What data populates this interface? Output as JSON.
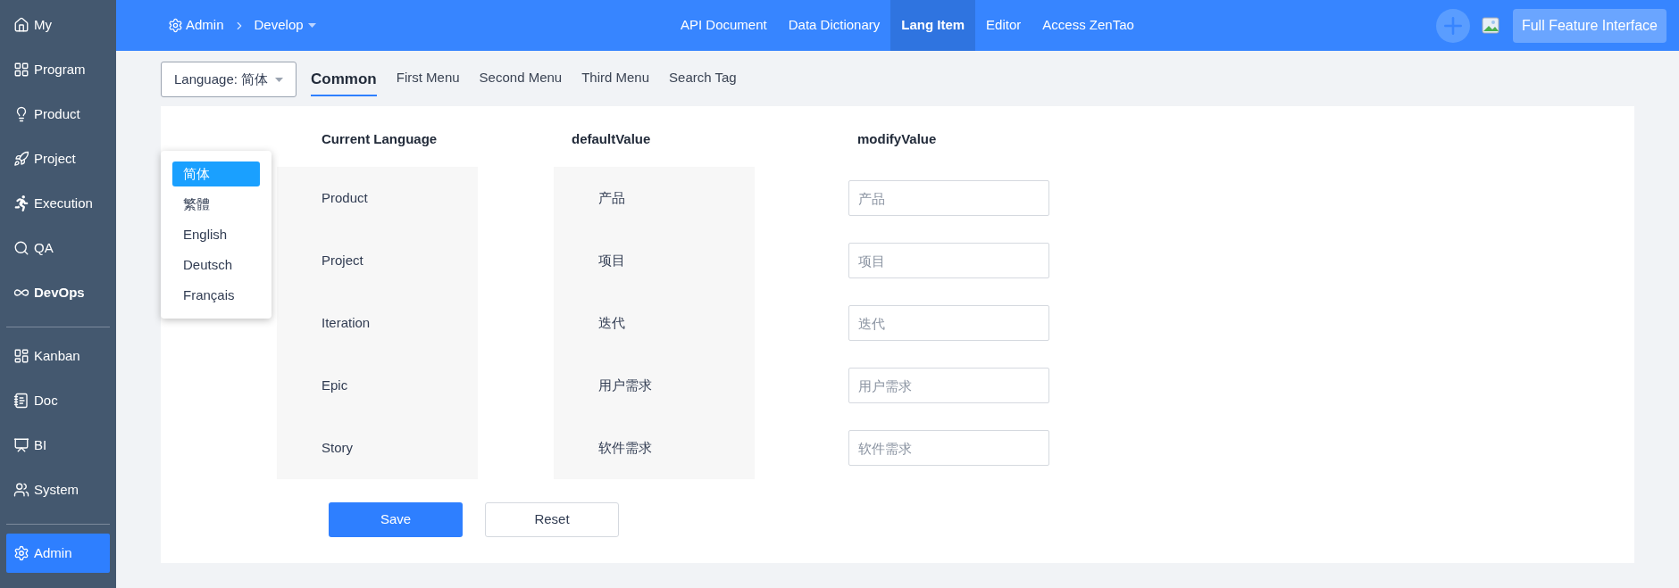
{
  "sidebar": {
    "items": [
      {
        "label": "My",
        "selected": false
      },
      {
        "label": "Program",
        "selected": false
      },
      {
        "label": "Product",
        "selected": false
      },
      {
        "label": "Project",
        "selected": false
      },
      {
        "label": "Execution",
        "selected": false
      },
      {
        "label": "QA",
        "selected": false
      },
      {
        "label": "DevOps",
        "selected": false
      },
      {
        "label": "Kanban",
        "selected": false
      },
      {
        "label": "Doc",
        "selected": false
      },
      {
        "label": "BI",
        "selected": false
      },
      {
        "label": "System",
        "selected": false
      },
      {
        "label": "Admin",
        "selected": true
      }
    ]
  },
  "breadcrumb": {
    "root": "Admin",
    "current": "Develop"
  },
  "top_nav": [
    {
      "label": "API Document",
      "selected": false
    },
    {
      "label": "Data Dictionary",
      "selected": false
    },
    {
      "label": "Lang Item",
      "selected": true
    },
    {
      "label": "Editor",
      "selected": false
    },
    {
      "label": "Access ZenTao",
      "selected": false
    }
  ],
  "full_feature_button": "Full Feature Interface",
  "language_select": {
    "value": "Language: 简体",
    "expanded": true,
    "options": [
      {
        "label": "简体",
        "selected": true
      },
      {
        "label": "繁體",
        "selected": false
      },
      {
        "label": "English",
        "selected": false
      },
      {
        "label": "Deutsch",
        "selected": false
      },
      {
        "label": "Français",
        "selected": false
      }
    ]
  },
  "tabs": [
    {
      "label": "Common",
      "selected": true
    },
    {
      "label": "First Menu",
      "selected": false
    },
    {
      "label": "Second Menu",
      "selected": false
    },
    {
      "label": "Third Menu",
      "selected": false
    },
    {
      "label": "Search Tag",
      "selected": false
    }
  ],
  "table": {
    "columns": [
      "Current Language",
      "defaultValue",
      "modifyValue"
    ],
    "rows": [
      {
        "current": "Product",
        "default_value": "产品",
        "placeholder": "产品"
      },
      {
        "current": "Project",
        "default_value": "项目",
        "placeholder": "项目"
      },
      {
        "current": "Iteration",
        "default_value": "迭代",
        "placeholder": "迭代"
      },
      {
        "current": "Epic",
        "default_value": "用户需求",
        "placeholder": "用户需求"
      },
      {
        "current": "Story",
        "default_value": "软件需求",
        "placeholder": "软件需求"
      }
    ]
  },
  "buttons": [
    {
      "label": "Save",
      "kind": "primary"
    },
    {
      "label": "Reset",
      "kind": "secondary"
    }
  ]
}
